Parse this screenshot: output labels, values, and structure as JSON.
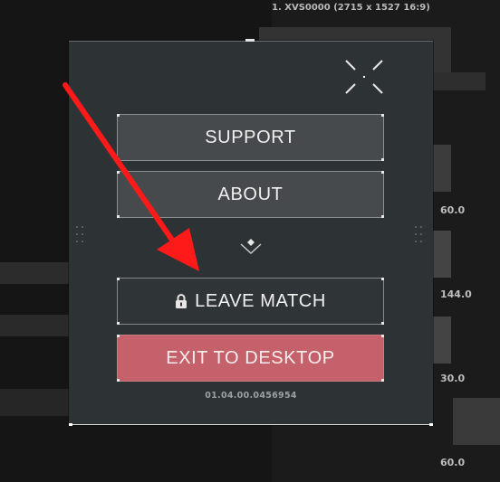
{
  "background": {
    "header_text": "1. XVS0000 (2715 x 1527 16:9)",
    "values": [
      "60.0",
      "144.0",
      "30.0",
      "60.0"
    ]
  },
  "menu": {
    "support_label": "SUPPORT",
    "about_label": "ABOUT",
    "leave_match_label": "LEAVE MATCH",
    "exit_label": "EXIT TO DESKTOP",
    "version": "01.04.00.0456954"
  },
  "icons": {
    "top_right": "focus-corners-icon",
    "divider": "chevron-down-icon",
    "leave_match": "lock-icon",
    "annotation": "red-arrow"
  },
  "colors": {
    "panel": "#2d3234",
    "button": "#464a4c",
    "button_border": "#8c8f91",
    "exit_button": "#c5616a",
    "arrow": "#ff1a1a"
  }
}
